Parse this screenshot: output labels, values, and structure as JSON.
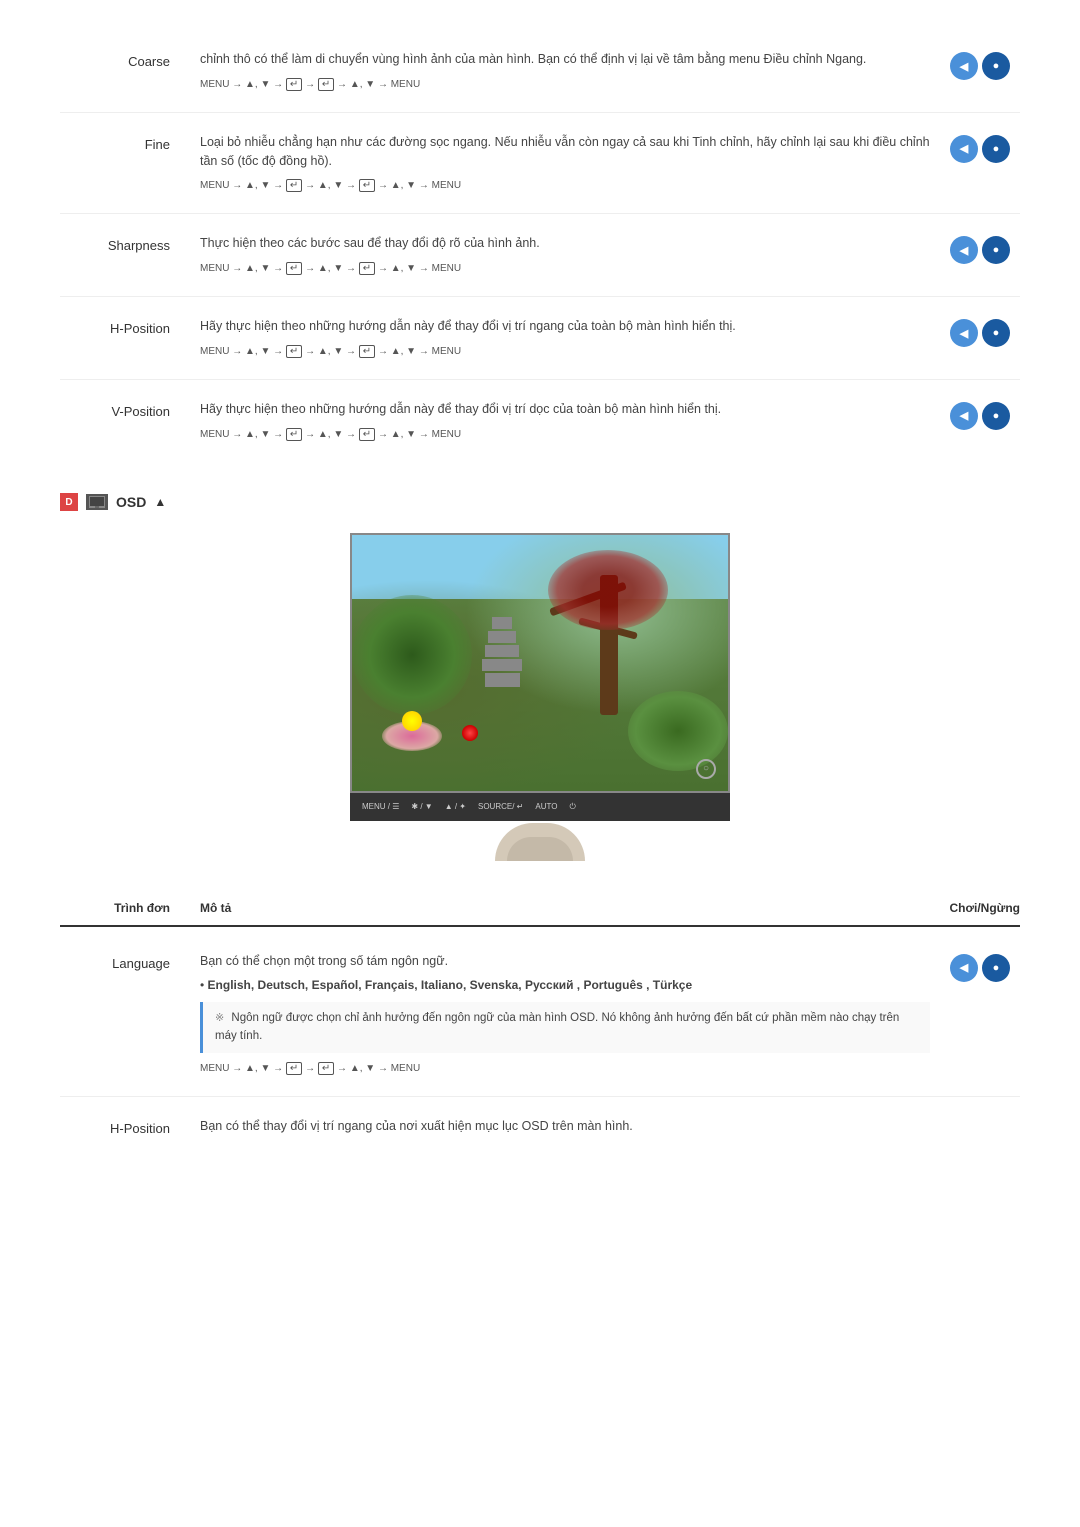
{
  "settings": {
    "rows": [
      {
        "id": "coarse",
        "label": "Coarse",
        "description": "chỉnh thô có thể làm di chuyển vùng hình ảnh của màn hình. Bạn có thể định vị lại về tâm bằng menu Điều chỉnh Ngang.",
        "menu_path": "MENU → ▲, ▼ → ↵ → ↵ → ▲, ▼ → MENU",
        "has_buttons": true
      },
      {
        "id": "fine",
        "label": "Fine",
        "description": "Loại bỏ nhiễu chẳng hạn như các đường sọc ngang. Nếu nhiễu vẫn còn ngay cả sau khi Tinh chỉnh, hãy chỉnh lại sau khi điều chỉnh tần số (tốc độ đồng hồ).",
        "menu_path": "MENU → ▲, ▼ → ↵ → ▲, ▼ → ↵ → ▲, ▼ → MENU",
        "has_buttons": true
      },
      {
        "id": "sharpness",
        "label": "Sharpness",
        "description": "Thực hiện theo các bước sau để thay đổi độ rõ của hình ảnh.",
        "menu_path": "MENU → ▲, ▼ → ↵ → ▲, ▼ → ↵ → ▲, ▼ → MENU",
        "has_buttons": true
      },
      {
        "id": "hposition",
        "label": "H-Position",
        "description": "Hãy thực hiện theo những hướng dẫn này để thay đổi vị trí ngang của toàn bộ màn hình hiển thị.",
        "menu_path": "MENU → ▲, ▼ → ↵ → ▲, ▼ → ↵ → ▲, ▼ → MENU",
        "has_buttons": true
      },
      {
        "id": "vposition",
        "label": "V-Position",
        "description": "Hãy thực hiện theo những hướng dẫn này để thay đổi vị trí dọc của toàn bộ màn hình hiển thị.",
        "menu_path": "MENU → ▲, ▼ → ↵ → ▲, ▼ → ↵ → ▲, ▼ → MENU",
        "has_buttons": true
      }
    ]
  },
  "osd_section": {
    "title": "OSD",
    "icon_d": "D",
    "icon_label": "OSD ▲"
  },
  "monitor_controls": {
    "menu_label": "MENU / ☰",
    "brightness_label": "✱& / ▼",
    "source_label": "▲ / ✦",
    "input_label": "SOURCE/ ↵",
    "auto_label": "AUTO",
    "power_label": "⏻"
  },
  "osd_table": {
    "col_menu": "Trình đơn",
    "col_desc": "Mô tả",
    "col_play": "Chơi/Ngừng",
    "rows": [
      {
        "id": "language",
        "label": "Language",
        "description_main": "Bạn có thể chọn một trong số tám ngôn ngữ.",
        "bullet": "English, Deutsch, Español, Français,  Italiano, Svenska, Русский , Português , Türkçe",
        "note": "Ngôn ngữ được chọn chỉ ảnh hưởng đến ngôn ngữ của màn hình OSD. Nó không ảnh hưởng đến bất cứ phần mềm nào chạy trên máy tính.",
        "menu_path": "MENU → ▲, ▼ → ↵ → ↵ → ▲, ▼ → MENU",
        "has_buttons": true
      },
      {
        "id": "hposition_osd",
        "label": "H-Position",
        "description_main": "Bạn có thể thay đổi vị trí ngang của nơi xuất hiện mục lục OSD trên màn hình.",
        "menu_path": "",
        "has_buttons": false
      }
    ]
  }
}
